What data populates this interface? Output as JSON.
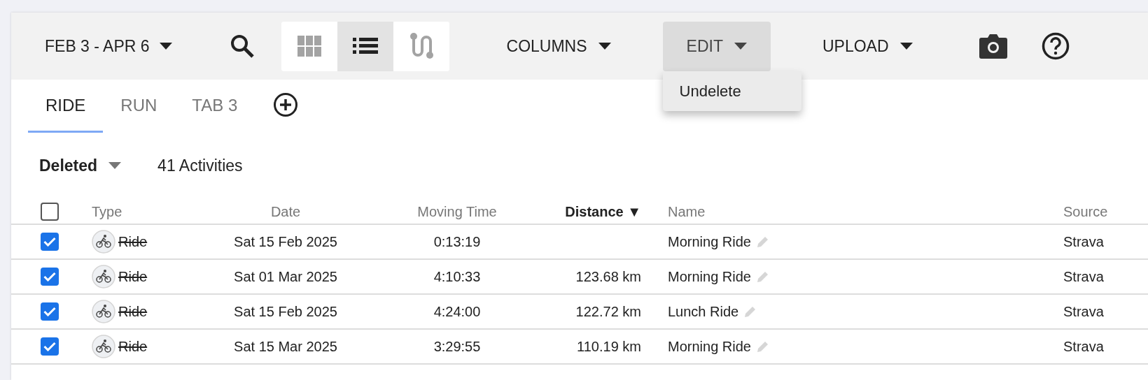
{
  "toolbar": {
    "date_range": "FEB 3 - APR 6",
    "view_toggle": [
      {
        "kind": "grid",
        "selected": false
      },
      {
        "kind": "list",
        "selected": true
      },
      {
        "kind": "route",
        "selected": false
      }
    ],
    "menus": [
      {
        "label": "COLUMNS",
        "open": false
      },
      {
        "label": "EDIT",
        "open": true
      },
      {
        "label": "UPLOAD",
        "open": false
      }
    ]
  },
  "edit_menu": {
    "items": [
      "Undelete"
    ]
  },
  "tabs": [
    {
      "label": "RIDE",
      "selected": true
    },
    {
      "label": "RUN",
      "selected": false
    },
    {
      "label": "TAB 3",
      "selected": false
    }
  ],
  "filter": {
    "value": "Deleted",
    "count": "41 Activities"
  },
  "table": {
    "all_checked": false,
    "columns": [
      {
        "label": "Type",
        "sorted": false
      },
      {
        "label": "Date",
        "sorted": false
      },
      {
        "label": "Moving Time",
        "sorted": false
      },
      {
        "label": "Distance",
        "sorted": true,
        "sort_indicator": "▼"
      },
      {
        "label": "Name",
        "sorted": false
      },
      {
        "label": "Source",
        "sorted": false
      }
    ],
    "rows": [
      {
        "checked": true,
        "type": "Ride",
        "deleted": true,
        "date": "Sat 15 Feb 2025",
        "moving_time": "0:13:19",
        "name": "Morning Ride",
        "source": "Strava"
      },
      {
        "checked": true,
        "type": "Ride",
        "deleted": true,
        "date": "Sat 01 Mar 2025",
        "moving_time": "4:10:33",
        "distance": "123.68 km",
        "name": "Morning Ride",
        "source": "Strava"
      },
      {
        "checked": true,
        "type": "Ride",
        "deleted": true,
        "date": "Sat 15 Feb 2025",
        "moving_time": "4:24:00",
        "distance": "122.72 km",
        "name": "Lunch Ride",
        "source": "Strava"
      },
      {
        "checked": true,
        "type": "Ride",
        "deleted": true,
        "date": "Sat 15 Mar 2025",
        "moving_time": "3:29:55",
        "distance": "110.19 km",
        "name": "Morning Ride",
        "source": "Strava"
      }
    ]
  }
}
